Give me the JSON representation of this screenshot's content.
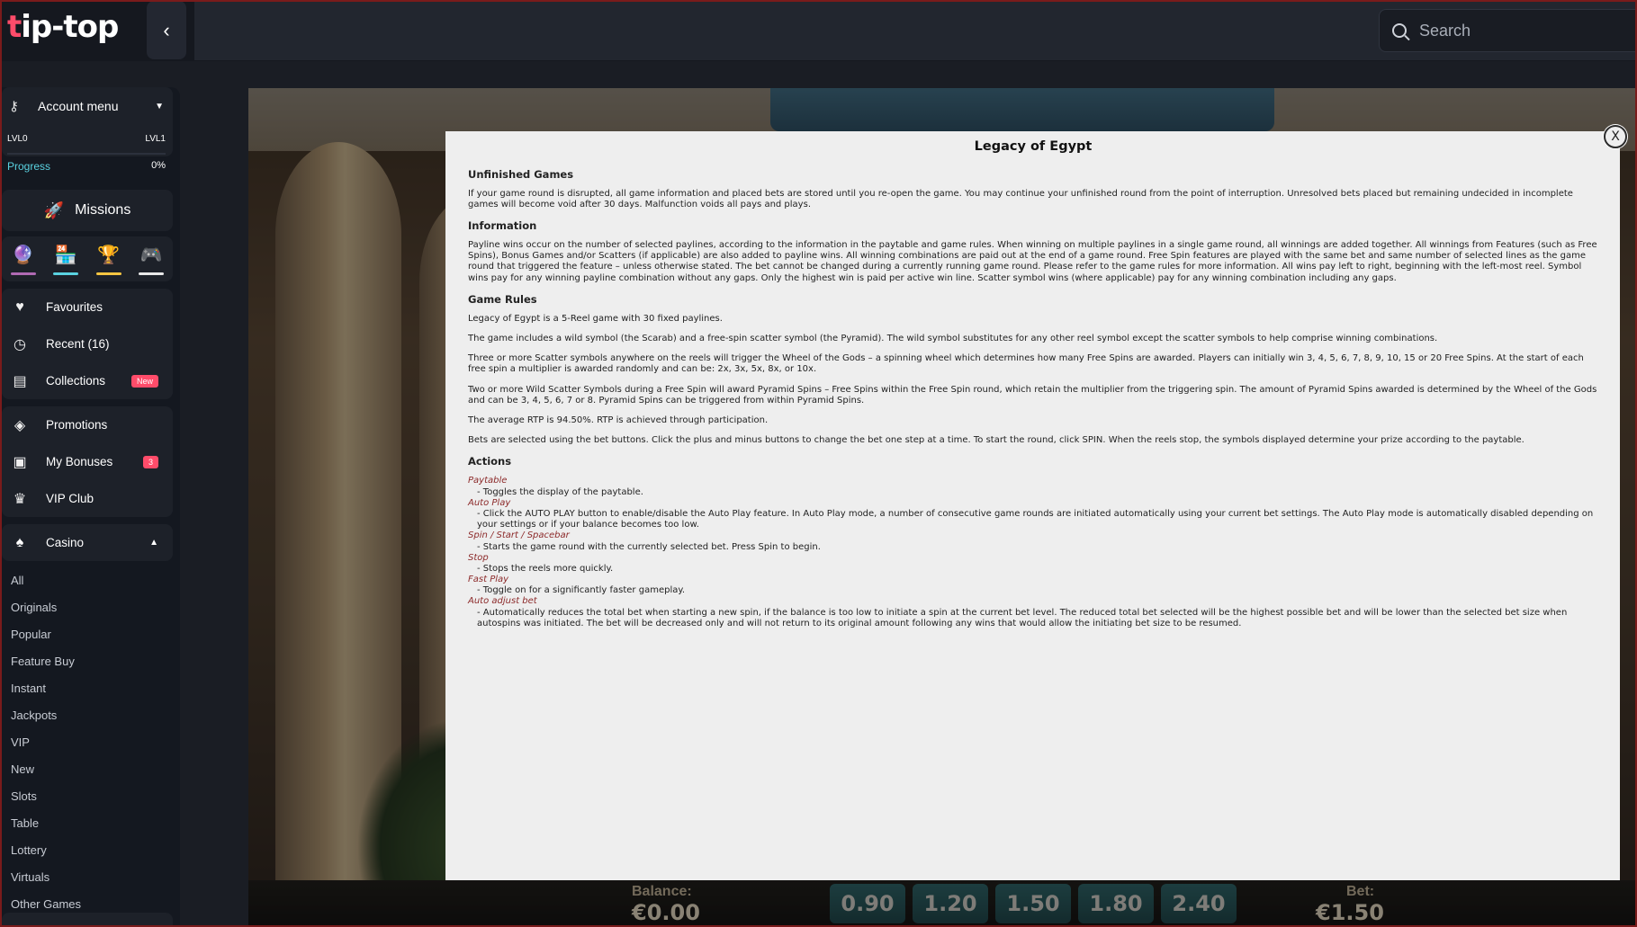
{
  "header": {
    "logo_text_a": "t",
    "logo_text_b": "ip-top",
    "collapse_icon": "chevron-left-icon",
    "search_placeholder": "Search"
  },
  "sidebar": {
    "account": {
      "label": "Account menu",
      "level_left": "LVL0",
      "level_right": "LVL1",
      "progress_label": "Progress",
      "progress_value": "0%",
      "progress_fraction": 0
    },
    "missions_label": "Missions",
    "mission_icons": [
      {
        "icon": "orb-icon",
        "glyph": "🔮",
        "color": "#b06ab3"
      },
      {
        "icon": "store-icon",
        "glyph": "🏪",
        "color": "#5ad2e0"
      },
      {
        "icon": "trophy-icon",
        "glyph": "🏆",
        "color": "#f5c542"
      },
      {
        "icon": "gamepad-icon",
        "glyph": "🎮",
        "color": "#e8e8e8"
      }
    ],
    "group1": [
      {
        "label": "Favourites",
        "icon": "heart-icon",
        "glyph": "♥"
      },
      {
        "label": "Recent (16)",
        "icon": "clock-icon",
        "glyph": "◷"
      },
      {
        "label": "Collections",
        "icon": "collections-icon",
        "glyph": "▤",
        "badge": "New"
      }
    ],
    "group2": [
      {
        "label": "Promotions",
        "icon": "tag-icon",
        "glyph": "◈"
      },
      {
        "label": "My Bonuses",
        "icon": "gift-icon",
        "glyph": "▣",
        "badge": "3"
      },
      {
        "label": "VIP Club",
        "icon": "crown-icon",
        "glyph": "♛"
      }
    ],
    "casino": {
      "label": "Casino",
      "items": [
        "All",
        "Originals",
        "Popular",
        "Feature Buy",
        "Instant",
        "Jackpots",
        "VIP",
        "New",
        "Slots",
        "Table",
        "Lottery",
        "Virtuals",
        "Other Games"
      ]
    }
  },
  "game": {
    "balance_label": "Balance:",
    "balance_value": "€0.00",
    "bet_label": "Bet:",
    "bet_value": "€1.50",
    "bet_options": [
      "0.90",
      "1.20",
      "1.50",
      "1.80",
      "2.40"
    ]
  },
  "modal": {
    "title": "Legacy of Egypt",
    "close_label": "X",
    "sections": {
      "unfinished_heading": "Unfinished Games",
      "unfinished_text": "If your game round is disrupted, all game information and placed bets are stored until you re-open the game. You may continue your unfinished round from the point of interruption. Unresolved bets placed but remaining undecided in incomplete games will become void after 30 days. Malfunction voids all pays and plays.",
      "info_heading": "Information",
      "info_text": "Payline wins occur on the number of selected paylines, according to the information in the paytable and game rules. When winning on multiple paylines in a single game round, all winnings are added together. All winnings from Features (such as Free Spins), Bonus Games and/or Scatters (if applicable) are also added to payline wins. All winning combinations are paid out at the end of a game round. Free Spin features are played with the same bet and same number of selected lines as the game round that triggered the feature – unless otherwise stated. The bet cannot be changed during a currently running game round. Please refer to the game rules for more information. All wins pay left to right, beginning with the left-most reel. Symbol wins pay for any winning payline combination without any gaps. Only the highest win is paid per active win line. Scatter symbol wins (where applicable) pay for any winning combination including any gaps.",
      "rules_heading": "Game Rules",
      "rules_1": "Legacy of Egypt is a 5-Reel game with 30 fixed paylines.",
      "rules_2": "The game includes a wild symbol (the Scarab) and a free-spin scatter symbol (the Pyramid). The wild symbol substitutes for any other reel symbol except the scatter symbols to help comprise winning combinations.",
      "rules_3": "Three or more Scatter symbols anywhere on the reels will trigger the Wheel of the Gods – a spinning wheel which determines how many Free Spins are awarded. Players can initially win 3, 4, 5, 6, 7, 8, 9, 10, 15 or 20 Free Spins. At the start of each free spin a multiplier is awarded randomly and can be: 2x, 3x, 5x, 8x, or 10x.",
      "rules_4": "Two or more Wild Scatter Symbols during a Free Spin will award Pyramid Spins – Free Spins within the Free Spin round, which retain the multiplier from the triggering spin. The amount of Pyramid Spins awarded is determined by the Wheel of the Gods and can be 3, 4, 5, 6, 7 or 8. Pyramid Spins can be triggered from within Pyramid Spins.",
      "rules_5": "The average RTP is 94.50%. RTP is achieved through participation.",
      "rules_6": "Bets are selected using the bet buttons. Click the plus and minus buttons to change the bet one step at a time. To start the round, click SPIN. When the reels stop, the symbols displayed determine your prize according to the paytable.",
      "actions_heading": "Actions",
      "actions": [
        {
          "name": "Paytable",
          "desc": "- Toggles the display of the paytable."
        },
        {
          "name": "Auto Play",
          "desc": "- Click the AUTO PLAY button to enable/disable the Auto Play feature. In Auto Play mode, a number of consecutive game rounds are initiated automatically using your current bet settings. The Auto Play mode is automatically disabled depending on your settings or if your balance becomes too low."
        },
        {
          "name": "Spin / Start / Spacebar",
          "desc": "- Starts the game round with the currently selected bet. Press Spin to begin."
        },
        {
          "name": "Stop",
          "desc": "- Stops the reels more quickly."
        },
        {
          "name": "Fast Play",
          "desc": "- Toggle on for a significantly faster gameplay."
        },
        {
          "name": "Auto adjust bet",
          "desc": "- Automatically reduces the total bet when starting a new spin, if the balance is too low to initiate a spin at the current bet level. The reduced total bet selected will be the highest possible bet and will be lower than the selected bet size when autospins was initiated. The bet will be decreased only and will not return to its original amount following any wins that would allow the initiating bet size to be resumed."
        }
      ]
    }
  }
}
